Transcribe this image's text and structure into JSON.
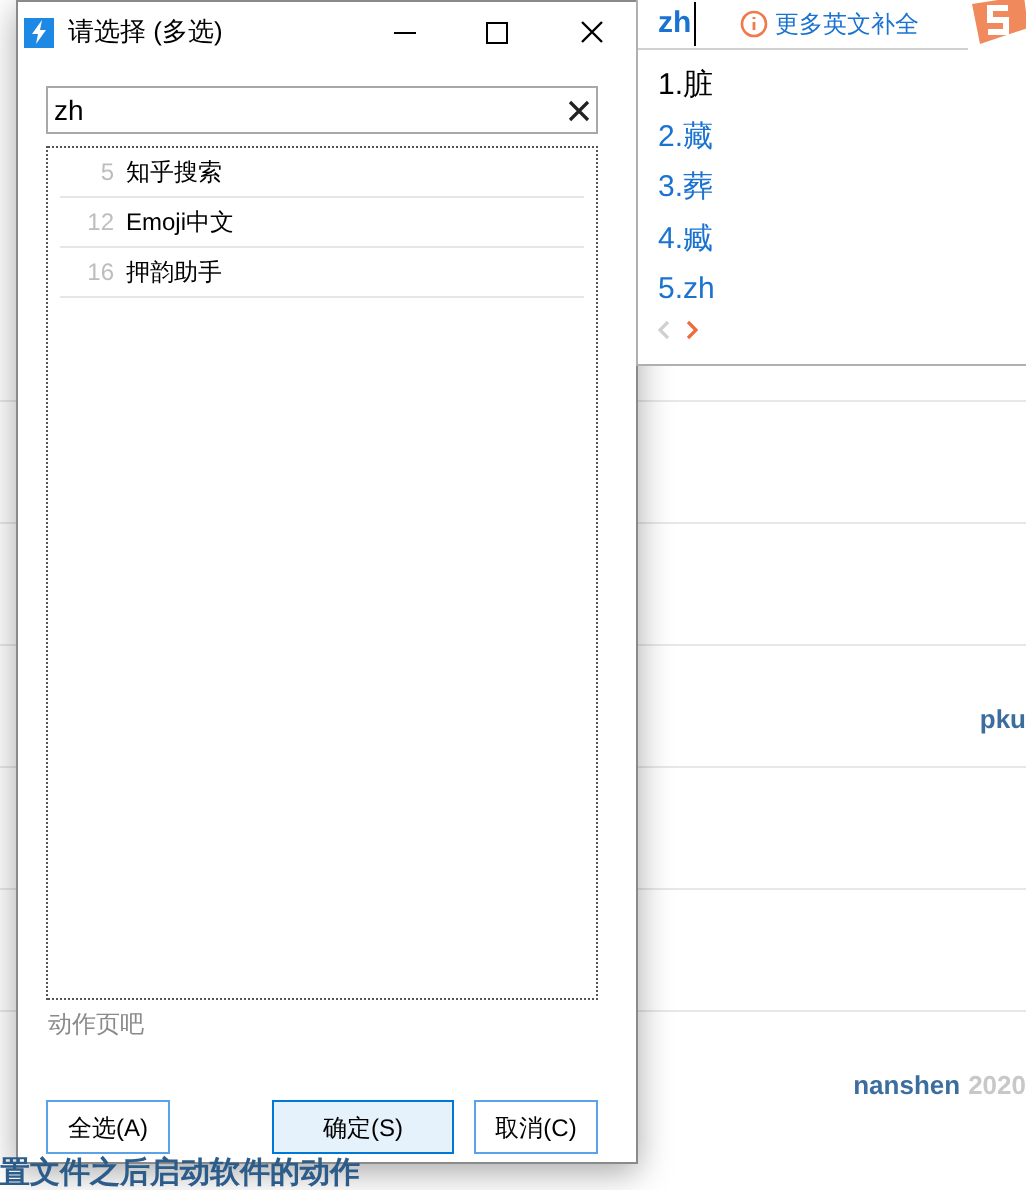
{
  "background_page": {
    "rows": [
      {
        "text": ""
      },
      {
        "text": ""
      },
      {
        "text": "pku"
      },
      {
        "text": ""
      },
      {
        "text": ""
      },
      {
        "text": "nanshen",
        "date": "2020"
      }
    ],
    "cut_heading": "置文件之后启动软件的动作"
  },
  "dialog": {
    "title": "请选择 (多选)",
    "search": {
      "value": "zh"
    },
    "items": [
      {
        "number": "5",
        "label": "知乎搜索"
      },
      {
        "number": "12",
        "label": "Emoji中文"
      },
      {
        "number": "16",
        "label": "押韵助手"
      }
    ],
    "footer_text": "动作页吧",
    "buttons": [
      {
        "label": "全选(A)",
        "default": false
      },
      {
        "label": "确定(S)",
        "default": true
      },
      {
        "label": "取消(C)",
        "default": false
      }
    ]
  },
  "ime": {
    "composition": "zh",
    "hint": "更多英文补全",
    "candidates": [
      {
        "label": "1.脏",
        "selected": true
      },
      {
        "label": "2.藏",
        "selected": false
      },
      {
        "label": "3.葬",
        "selected": false
      },
      {
        "label": "4.臧",
        "selected": false
      },
      {
        "label": "5.zh",
        "selected": false
      }
    ],
    "prev_disabled": true,
    "next_disabled": false
  }
}
